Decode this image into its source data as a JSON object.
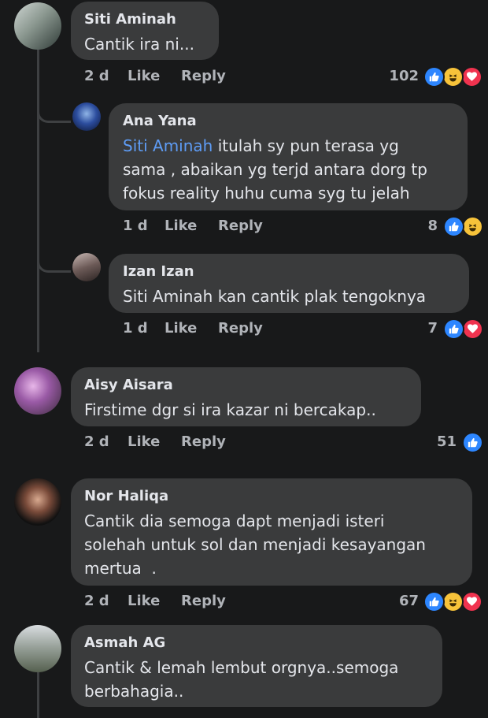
{
  "actions": {
    "like": "Like",
    "reply": "Reply"
  },
  "comments": [
    {
      "name": "Siti Aminah",
      "lines": [
        "Cantik ira ni..."
      ],
      "age": "2 d",
      "count": "102",
      "reactions": [
        "like-icon",
        "haha-icon",
        "love-icon"
      ]
    },
    {
      "name": "Ana Yana",
      "mention": "Siti Aminah",
      "lines": [
        " itulah sy pun terasa yg",
        "sama , abaikan yg terjd antara dorg tp",
        "fokus reality huhu cuma syg tu jelah"
      ],
      "age": "1 d",
      "count": "8",
      "reactions": [
        "like-icon",
        "haha-icon"
      ]
    },
    {
      "name": "Izan Izan",
      "lines": [
        "Siti Aminah kan cantik plak tengoknya"
      ],
      "age": "1 d",
      "count": "7",
      "reactions": [
        "like-icon",
        "love-icon"
      ]
    },
    {
      "name": "Aisy Aisara",
      "lines": [
        "Firstime dgr si ira kazar ni bercakap.."
      ],
      "age": "2 d",
      "count": "51",
      "reactions": [
        "like-icon"
      ]
    },
    {
      "name": "Nor Haliqa",
      "lines": [
        "Cantik dia semoga dapt menjadi isteri",
        "solehah untuk sol dan menjadi kesayangan",
        "mertua  ."
      ],
      "age": "2 d",
      "count": "67",
      "reactions": [
        "like-icon",
        "haha-icon",
        "love-icon"
      ]
    },
    {
      "name": "Asmah AG",
      "lines": [
        "Cantik & lemah lembut orgnya..semoga",
        "berbahagia.."
      ]
    }
  ],
  "colors": {
    "background": "#18191a",
    "bubble": "#3a3b3c",
    "mention": "#5e9cf5",
    "meta": "#b0b3b8",
    "like": "#2d86ff",
    "love": "#f0334f",
    "haha": "#f7c33a"
  }
}
